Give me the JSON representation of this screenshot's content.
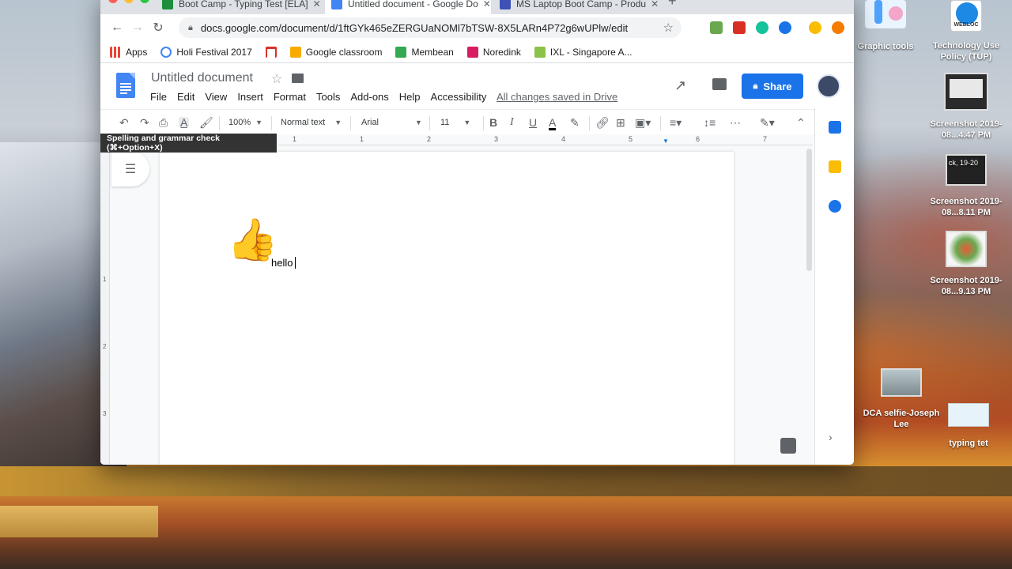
{
  "browser": {
    "tabs": [
      {
        "label": "Boot Camp - Typing Test [ELA]",
        "icon": "classroom-icon",
        "active": false
      },
      {
        "label": "Untitled document - Google Do",
        "icon": "docs-icon",
        "active": true
      },
      {
        "label": "MS Laptop Boot Camp - Produ",
        "icon": "forms-icon",
        "active": false
      }
    ],
    "url": "docs.google.com/document/d/1ftGYk465eZERGUaNOMl7bTSW-8X5LARn4P72g6wUPlw/edit",
    "bookmarks": [
      {
        "label": "Apps",
        "icon": "apps-grid-icon",
        "color": "#5f6368"
      },
      {
        "label": "Holi Festival 2017",
        "icon": "google-g-icon",
        "color": "#4285f4"
      },
      {
        "label": "",
        "icon": "gmail-icon",
        "color": "#d93025"
      },
      {
        "label": "Google classroom",
        "icon": "classroom-icon",
        "color": "#f9ab00"
      },
      {
        "label": "Membean",
        "icon": "membean-icon",
        "color": "#34a853"
      },
      {
        "label": "Noredink",
        "icon": "noredink-icon",
        "color": "#d81b60"
      },
      {
        "label": "IXL - Singapore A...",
        "icon": "ixl-icon",
        "color": "#8bc34a"
      }
    ]
  },
  "docs": {
    "title": "Untitled document",
    "menus": [
      "File",
      "Edit",
      "View",
      "Insert",
      "Format",
      "Tools",
      "Add-ons",
      "Help",
      "Accessibility"
    ],
    "saved_status": "All changes saved in Drive",
    "share_label": "Share",
    "toolbar": {
      "zoom": "100%",
      "style": "Normal text",
      "font": "Arial",
      "size": "11"
    },
    "tooltip": "Spelling and grammar check (⌘+Option+X)",
    "ruler_numbers": [
      "1",
      "1",
      "2",
      "3",
      "4",
      "5",
      "6",
      "7"
    ],
    "vruler_numbers": [
      "1",
      "2",
      "3"
    ],
    "body_emoji": "👍",
    "body_text": "hello"
  },
  "desktop": {
    "icons": [
      {
        "label": "Graphic tools",
        "icon": "folder-graphic-tools-icon"
      },
      {
        "label": "Technology Use Policy (TUP)",
        "icon": "webloc-icon",
        "badge": "WEBLOC"
      },
      {
        "label": "Screenshot 2019-08...4.47 PM",
        "icon": "screenshot-thumb-icon"
      },
      {
        "label": "Screenshot 2019-08...8.11 PM",
        "icon": "screenshot-thumb-icon",
        "thumb_text": "ck, 19-20"
      },
      {
        "label": "Screenshot 2019-08...9.13 PM",
        "icon": "screenshot-thumb-icon"
      },
      {
        "label": "DCA selfie-Joseph Lee",
        "icon": "photo-thumb-icon"
      },
      {
        "label": "typing tet",
        "icon": "screenshot-thumb-icon"
      }
    ]
  },
  "colors": {
    "docs_blue": "#4285f4",
    "share_blue": "#1a73e8",
    "tab_bar": "#dee1e6"
  }
}
